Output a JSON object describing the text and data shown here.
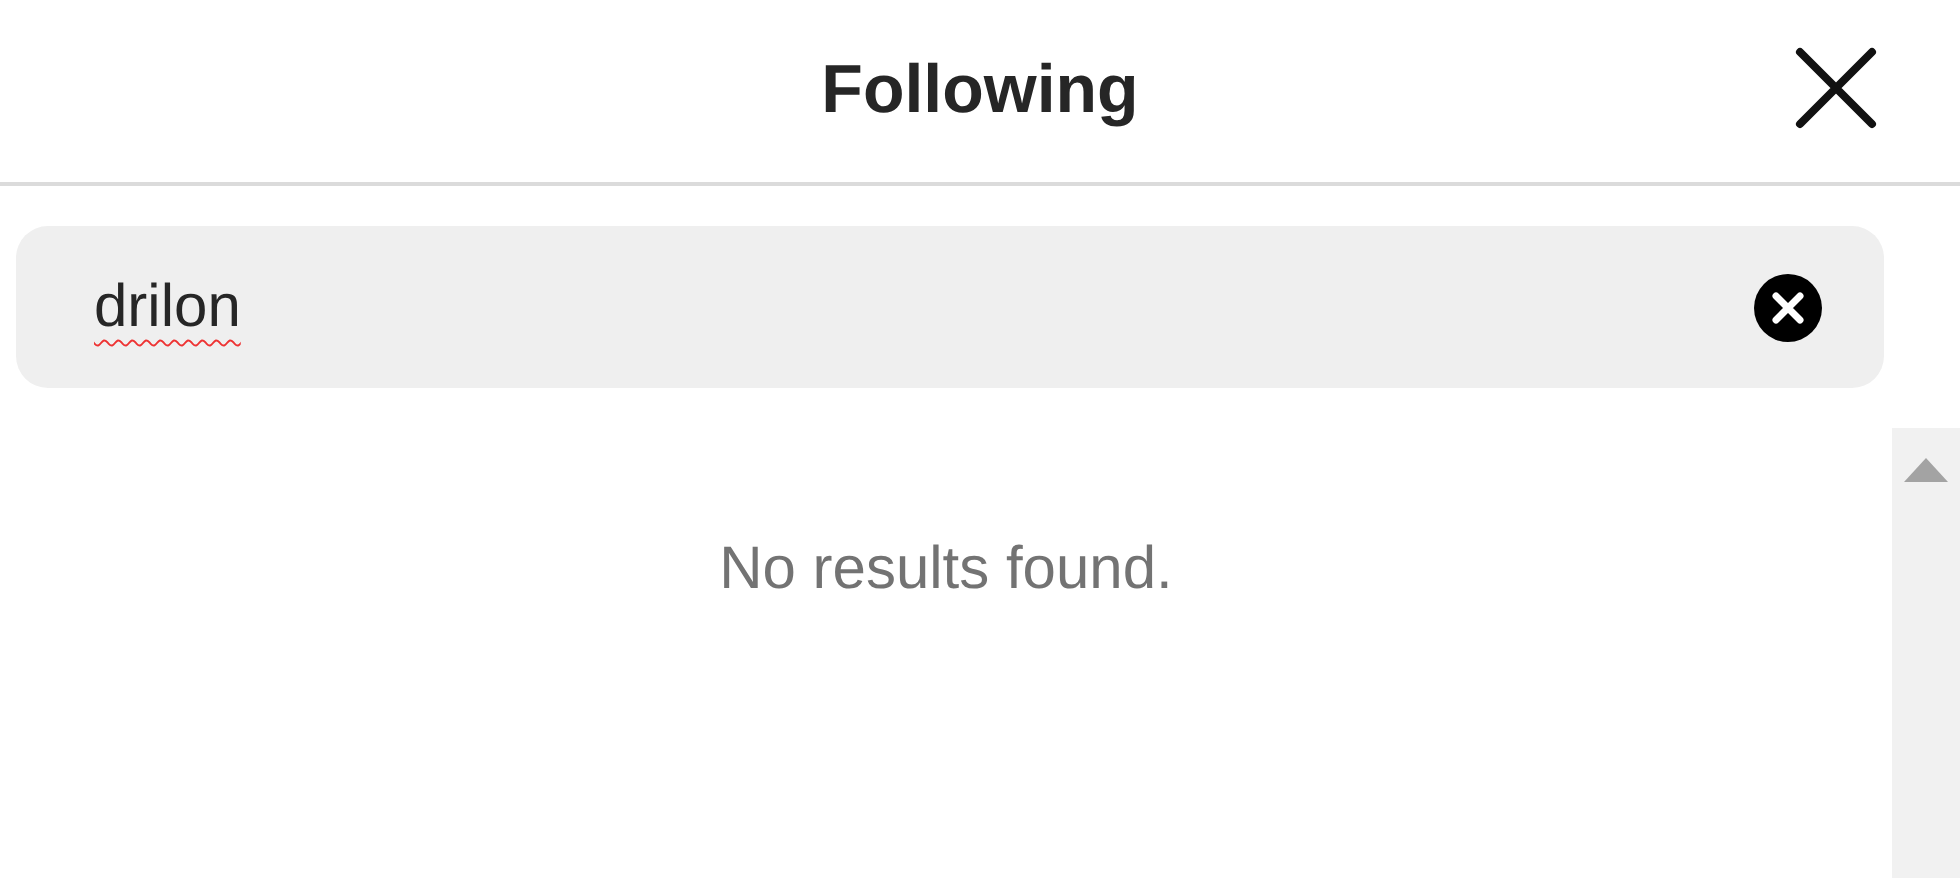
{
  "header": {
    "title": "Following"
  },
  "search": {
    "value": "drilon"
  },
  "results": {
    "message": "No results found."
  }
}
